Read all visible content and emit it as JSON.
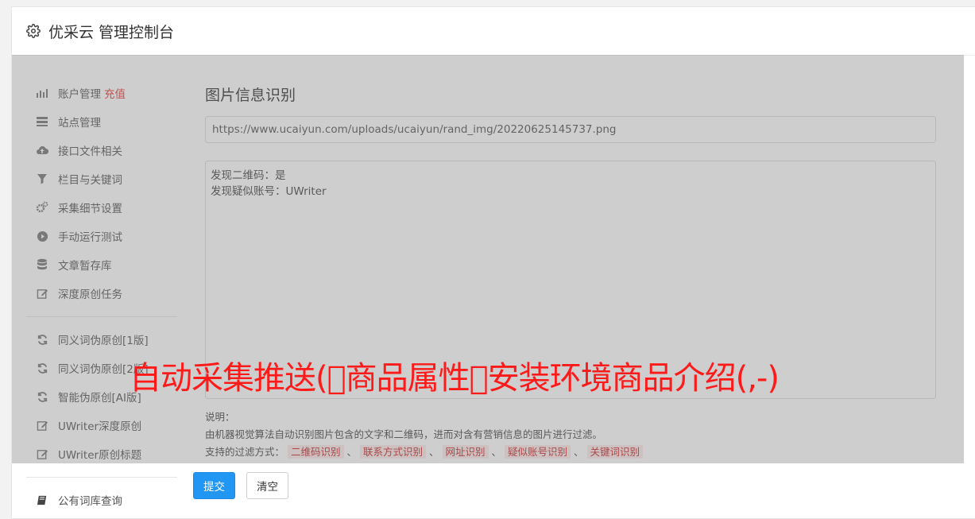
{
  "header": {
    "title": "优采云 管理控制台",
    "icon": "gear-icon"
  },
  "sidebar": {
    "items": [
      {
        "label": "账户管理",
        "badge": "充值",
        "icon": "bar-chart-icon"
      },
      {
        "label": "站点管理",
        "icon": "server-icon"
      },
      {
        "label": "接口文件相关",
        "icon": "cloud-upload-icon"
      },
      {
        "label": "栏目与关键词",
        "icon": "filter-icon"
      },
      {
        "label": "采集细节设置",
        "icon": "cogs-icon"
      },
      {
        "label": "手动运行测试",
        "icon": "play-circle-icon"
      },
      {
        "label": "文章暂存库",
        "icon": "database-icon"
      },
      {
        "label": "深度原创任务",
        "icon": "edit-icon"
      },
      {
        "label": "同义词伪原创[1版]",
        "icon": "refresh-icon"
      },
      {
        "label": "同义词伪原创[2版]",
        "icon": "refresh-icon"
      },
      {
        "label": "智能伪原创[AI版]",
        "icon": "refresh-icon"
      },
      {
        "label": "UWriter深度原创",
        "icon": "edit-icon"
      },
      {
        "label": "UWriter原创标题",
        "icon": "edit-icon"
      },
      {
        "label": "公有词库查询",
        "icon": "book-icon"
      }
    ]
  },
  "main": {
    "title": "图片信息识别",
    "url_value": "https://www.ucaiyun.com/uploads/ucaiyun/rand_img/20220625145737.png",
    "result_lines": [
      "发现二维码：是",
      "发现疑似账号：UWriter"
    ],
    "notes": {
      "heading": "说明：",
      "line1": "由机器视觉算法自动识别图片包含的文字和二维码，进而对含有营销信息的图片进行过滤。",
      "line2_prefix": "支持的过滤方式：",
      "tags": [
        "二维码识别",
        "联系方式识别",
        "网址识别",
        "疑似账号识别",
        "关键词识别"
      ],
      "separator": "、"
    }
  },
  "buttons": {
    "submit": "提交",
    "clear": "清空"
  },
  "watermark": "自动采集推送(￿商品属性￿安装环境商品介绍(,-)",
  "colors": {
    "primary": "#2196f3",
    "badge_red": "#e53935",
    "watermark_red": "#ff1a1a"
  }
}
